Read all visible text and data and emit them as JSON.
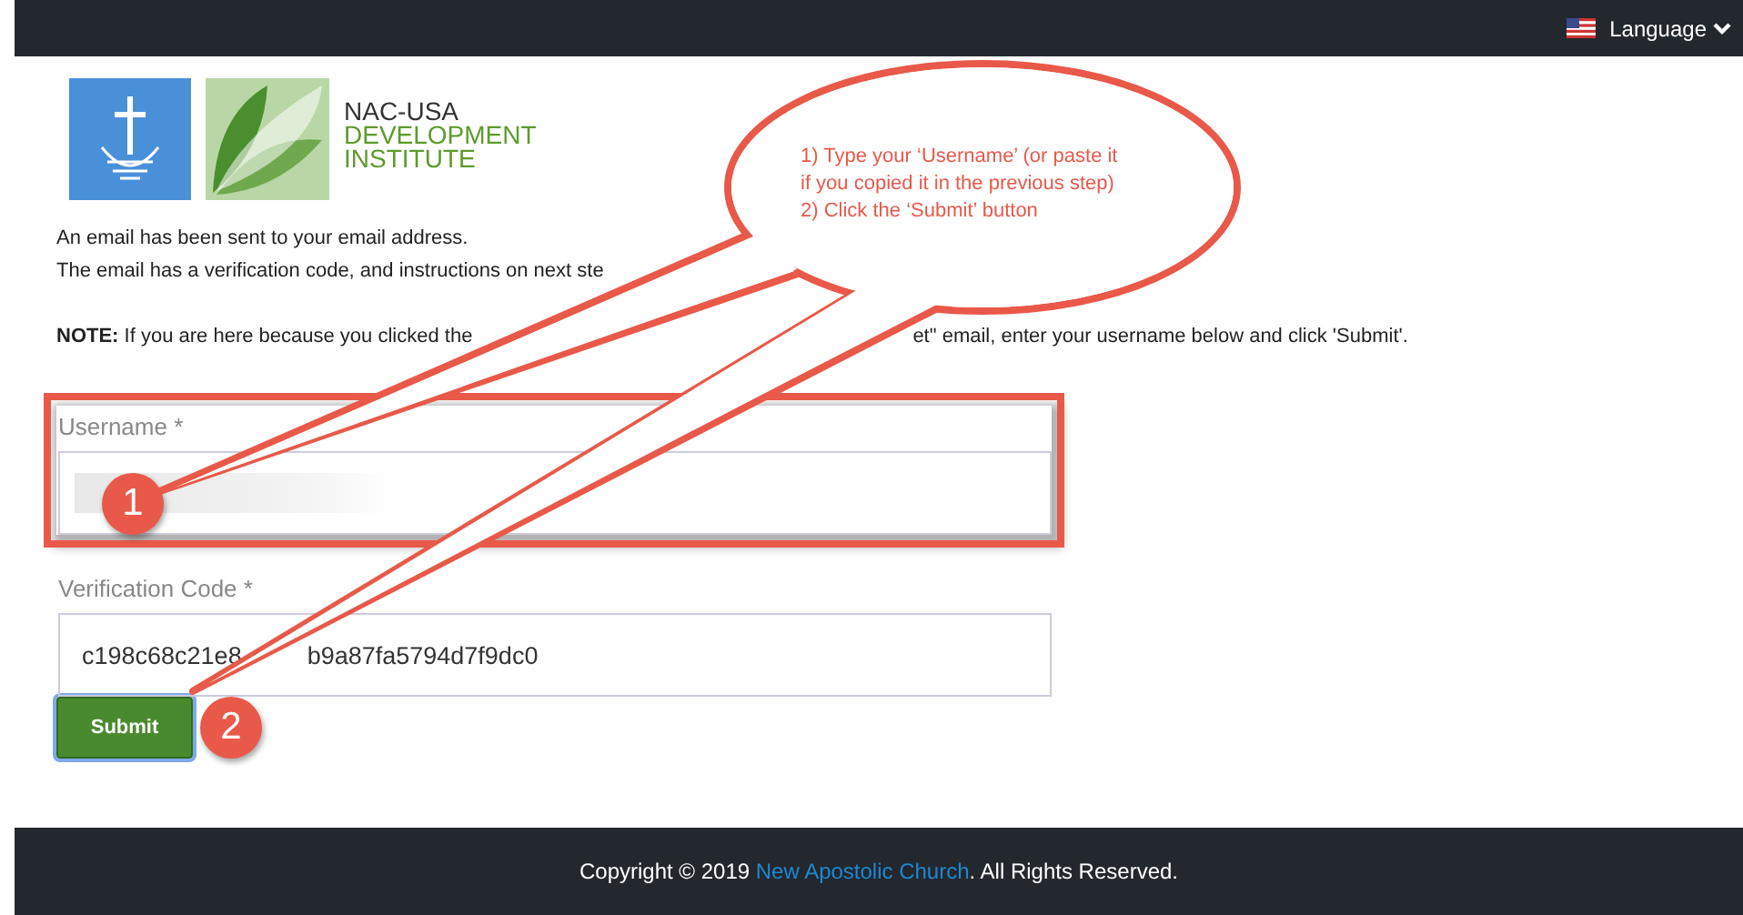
{
  "top_bar": {
    "language_label": "Language"
  },
  "logo": {
    "lines": [
      "NAC-USA",
      "DEVELOPMENT",
      "INSTITUTE"
    ]
  },
  "messages": [
    "An email has been sent to your email address.",
    "The email has a verification code, and instructions on next ste"
  ],
  "note": {
    "label": "NOTE:",
    "text_before": "If you are here because you clicked the",
    "text_after": "et\" email, enter your username below and click 'Submit'."
  },
  "fields": [
    {
      "label": "Username *",
      "kind": "blurred",
      "highlighted": true,
      "badge": "1"
    },
    {
      "label": "Verification Code *",
      "kind": "text",
      "value_start": "c198c68c21e8",
      "value_end": "b9a87fa5794d7f9dc0",
      "highlighted": false
    }
  ],
  "submit": {
    "label": "Submit",
    "focused": true,
    "badge": "2"
  },
  "callout": {
    "lines": [
      "1) Type your ‘Username’ (or paste it",
      "if you copied it in the previous step)",
      "2) Click the ‘Submit’ button"
    ]
  },
  "footer": {
    "before": "Copyright © 2019 ",
    "link": "New Apostolic Church",
    "after": ". All Rights Reserved."
  }
}
